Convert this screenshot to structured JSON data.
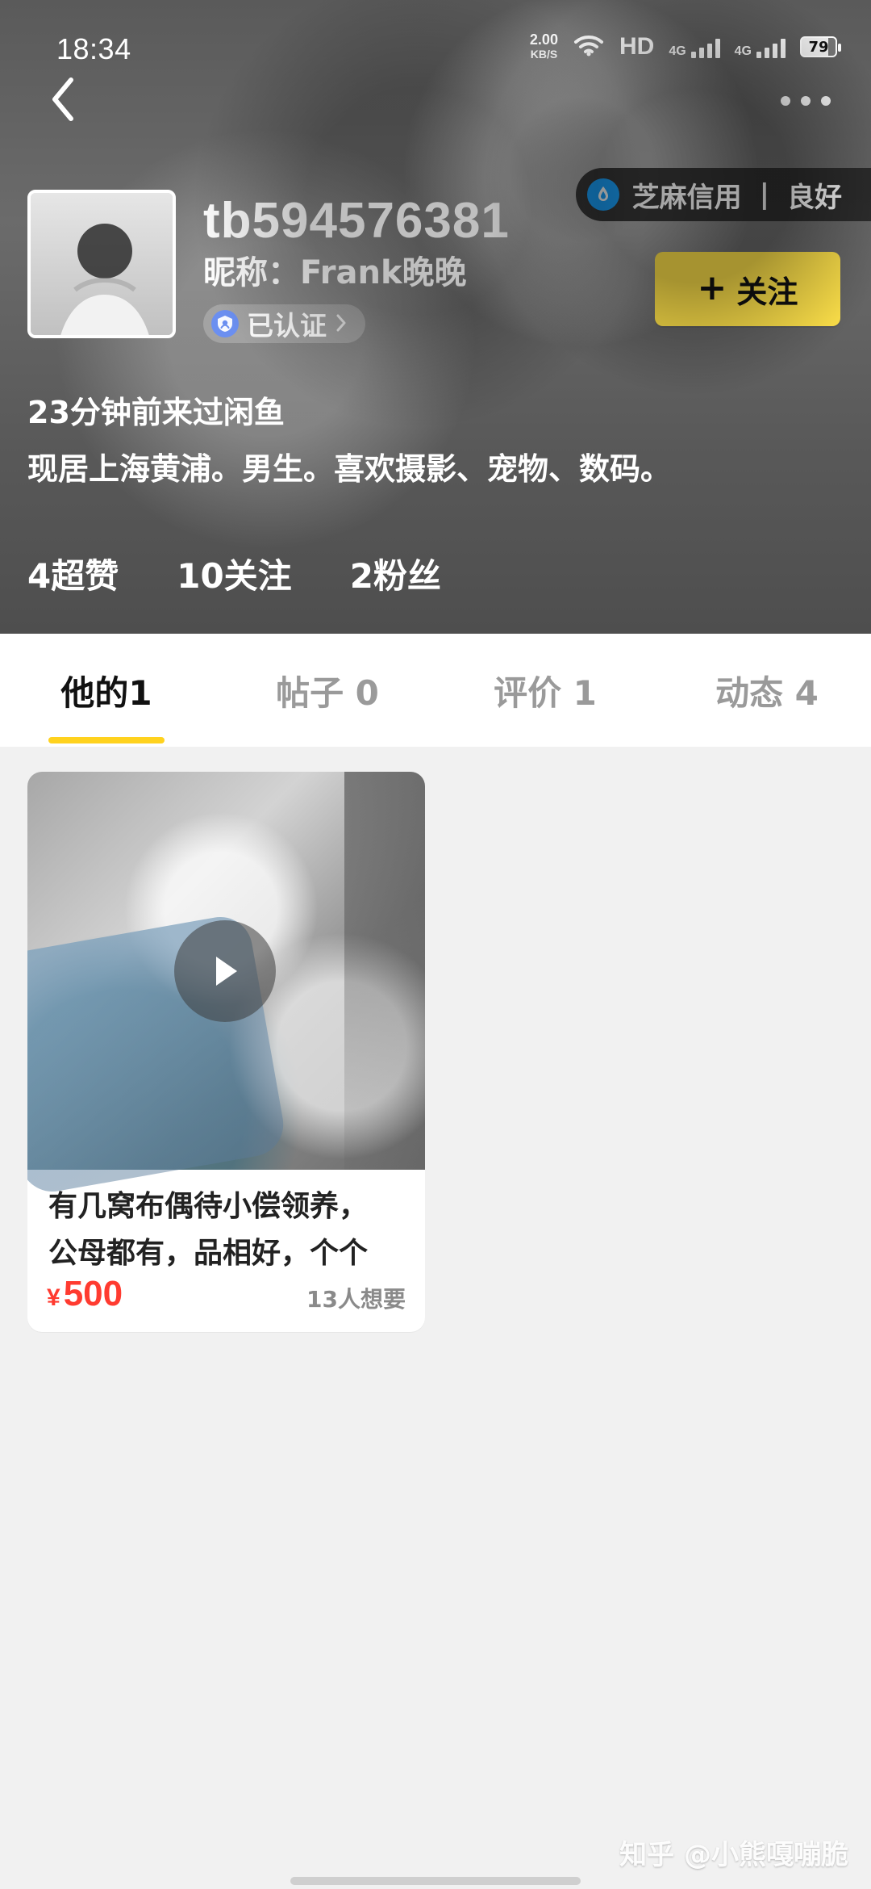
{
  "status_bar": {
    "time": "18:34",
    "net_speed_value": "2.00",
    "net_speed_unit": "KB/S",
    "hd_label": "HD",
    "sim1_label": "4G",
    "sim2_label": "4G",
    "battery_level": "79"
  },
  "profile": {
    "username": "tb594576381",
    "nickname": "昵称：Frank晚晚",
    "verified_label": "已认证",
    "credit": {
      "label": "芝麻信用",
      "separator": "|",
      "rating": "良好"
    },
    "follow_button": {
      "label": "关注",
      "icon": "plus-icon"
    },
    "last_seen": "23分钟前来过闲鱼",
    "bio": "现居上海黄浦。男生。喜欢摄影、宠物、数码。",
    "stats": {
      "super_likes": "4超赞",
      "following": "10关注",
      "followers": "2粉丝"
    }
  },
  "tabs": [
    {
      "label": "他的1"
    },
    {
      "label": "帖子 0"
    },
    {
      "label": "评价 1"
    },
    {
      "label": "动态 4"
    }
  ],
  "listing": {
    "title": "有几窝布偶待小偿领养，\n公母都有，品相好，个个",
    "price_symbol": "¥",
    "price": "500",
    "wants": "13人想要"
  },
  "watermark": "知乎 @小熊嘎嘣脆",
  "colors": {
    "accent_yellow": "#ffe24a",
    "tab_underline": "#ffd21e",
    "price_red": "#ff3b30",
    "credit_blue": "#1aa3ff",
    "verified_blue": "#6b8ff0"
  }
}
